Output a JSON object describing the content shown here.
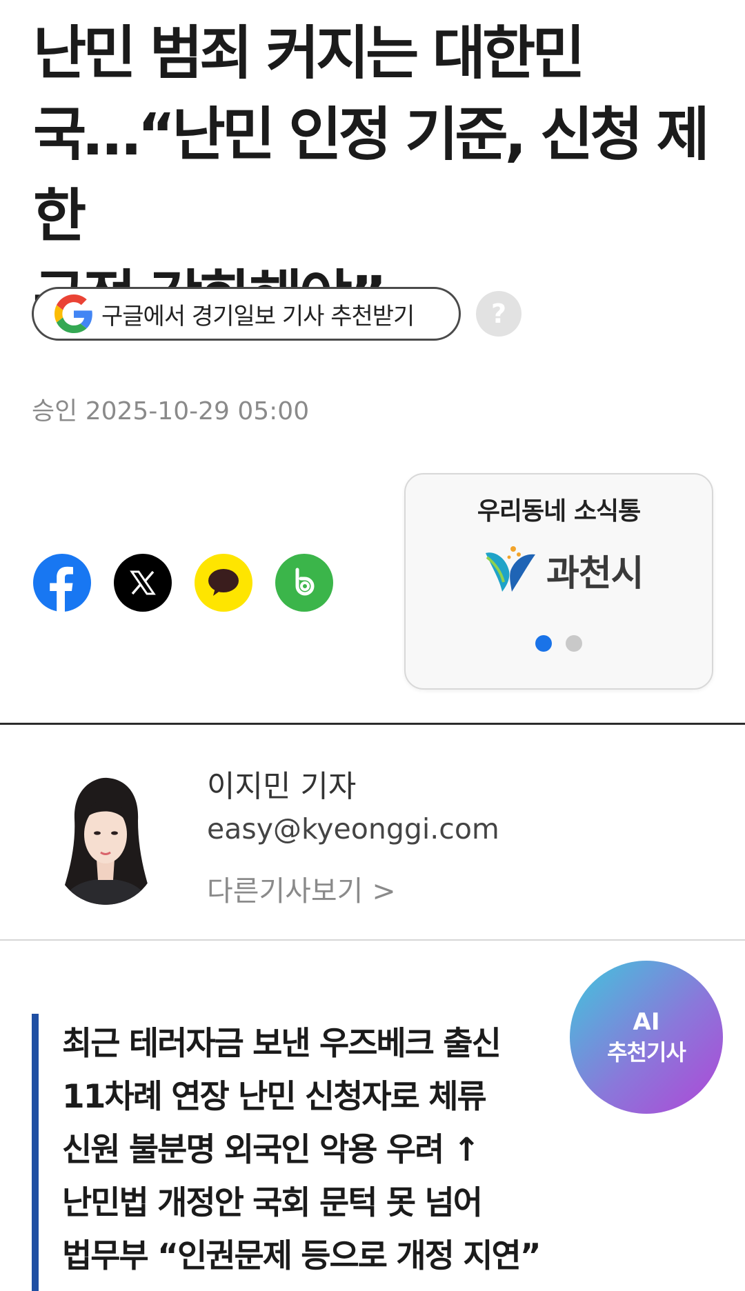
{
  "article": {
    "headline_lines": [
      "난민 범죄 커지는 대한민",
      "국…“난민 인정 기준, 신청 제한",
      "규정 강화해야”"
    ],
    "google_follow_label": "구글에서 경기일보 기사 추천받기",
    "help_label": "?",
    "approval_label": "승인",
    "approval_datetime": "2025-10-29 05:00"
  },
  "share": {
    "items": [
      {
        "name": "facebook",
        "color": "#1877f2"
      },
      {
        "name": "x",
        "color": "#000000"
      },
      {
        "name": "kakaotalk",
        "color": "#fee500"
      },
      {
        "name": "band",
        "color": "#3bb54a"
      }
    ]
  },
  "local_news": {
    "title": "우리동네 소식통",
    "logo_text": "과천시",
    "active_color": "#1a73e8",
    "inactive_color": "#c9c9c9"
  },
  "reporter": {
    "name": "이지민 기자",
    "email": "easy@kyeonggi.com",
    "more_link": "다른기사보기 >"
  },
  "ai_badge": {
    "line1": "AI",
    "line2": "추천기사"
  },
  "summary": {
    "lines": [
      "최근 테러자금 보낸 우즈베크 출신",
      "11차례 연장 난민 신청자로 체류",
      "신원 불분명 외국인 악용 우려 ↑",
      "난민법 개정안 국회 문턱 못 넘어",
      "법무부 “인권문제 등으로 개정 지연”"
    ]
  }
}
